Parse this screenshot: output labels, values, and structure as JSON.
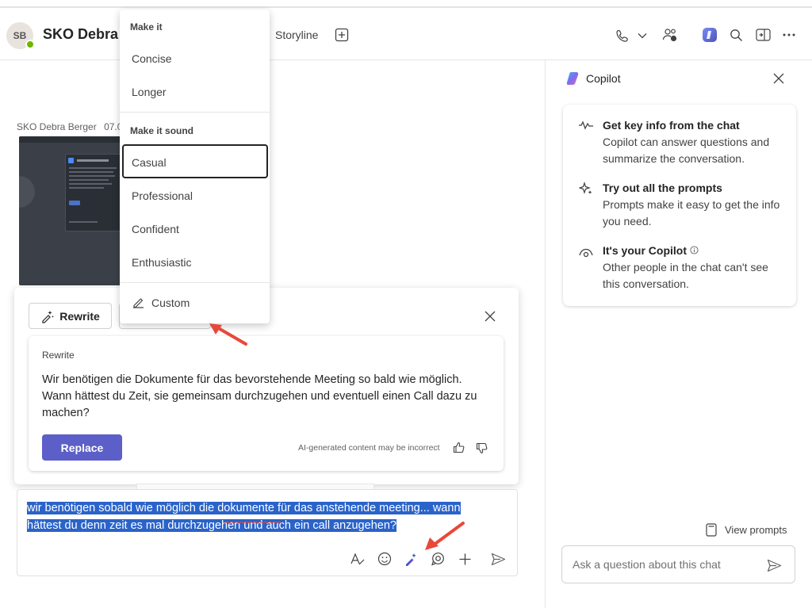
{
  "header": {
    "avatar_initials": "SB",
    "chat_title": "SKO Debra",
    "tab_storyline": "Storyline"
  },
  "message": {
    "sender": "SKO Debra Berger",
    "time_fragment": "07.0"
  },
  "tone_menu": {
    "section_length": "Make it",
    "length_options": [
      "Concise",
      "Longer"
    ],
    "section_tone": "Make it sound",
    "tone_options": [
      "Casual",
      "Professional",
      "Confident",
      "Enthusiastic"
    ],
    "selected_tone": "Casual",
    "custom_label": "Custom"
  },
  "rewrite_panel": {
    "rewrite_button": "Rewrite",
    "card_label": "Rewrite",
    "rewritten_text": "Wir benötigen die Dokumente für das bevorstehende Meeting so bald wie möglich. Wann hättest du Zeit, sie gemeinsam durchzugehen und eventuell einen Call dazu zu machen?",
    "replace_button": "Replace",
    "disclaimer": "AI-generated content may be incorrect"
  },
  "compose": {
    "text_line1": "wir benötigen sobald wie möglich die dokumente für das anstehende meeting... wann",
    "text_line2": "hättest du denn zeit es mal durchzugehen und auch ein call anzugehen?"
  },
  "copilot": {
    "title": "Copilot",
    "items": [
      {
        "title": "Get key info from the chat",
        "desc": "Copilot can answer questions and summarize the conversation."
      },
      {
        "title": "Try out all the prompts",
        "desc": "Prompts make it easy to get the info you need."
      },
      {
        "title": "It's your Copilot",
        "desc": "Other people in the chat can't see this conversation."
      }
    ],
    "view_prompts": "View prompts",
    "ask_placeholder": "Ask a question about this chat"
  },
  "colors": {
    "brand": "#5b5fc7",
    "selection": "#2a63c9",
    "presence": "#6bb700",
    "annotation_arrow": "#e8483b"
  }
}
